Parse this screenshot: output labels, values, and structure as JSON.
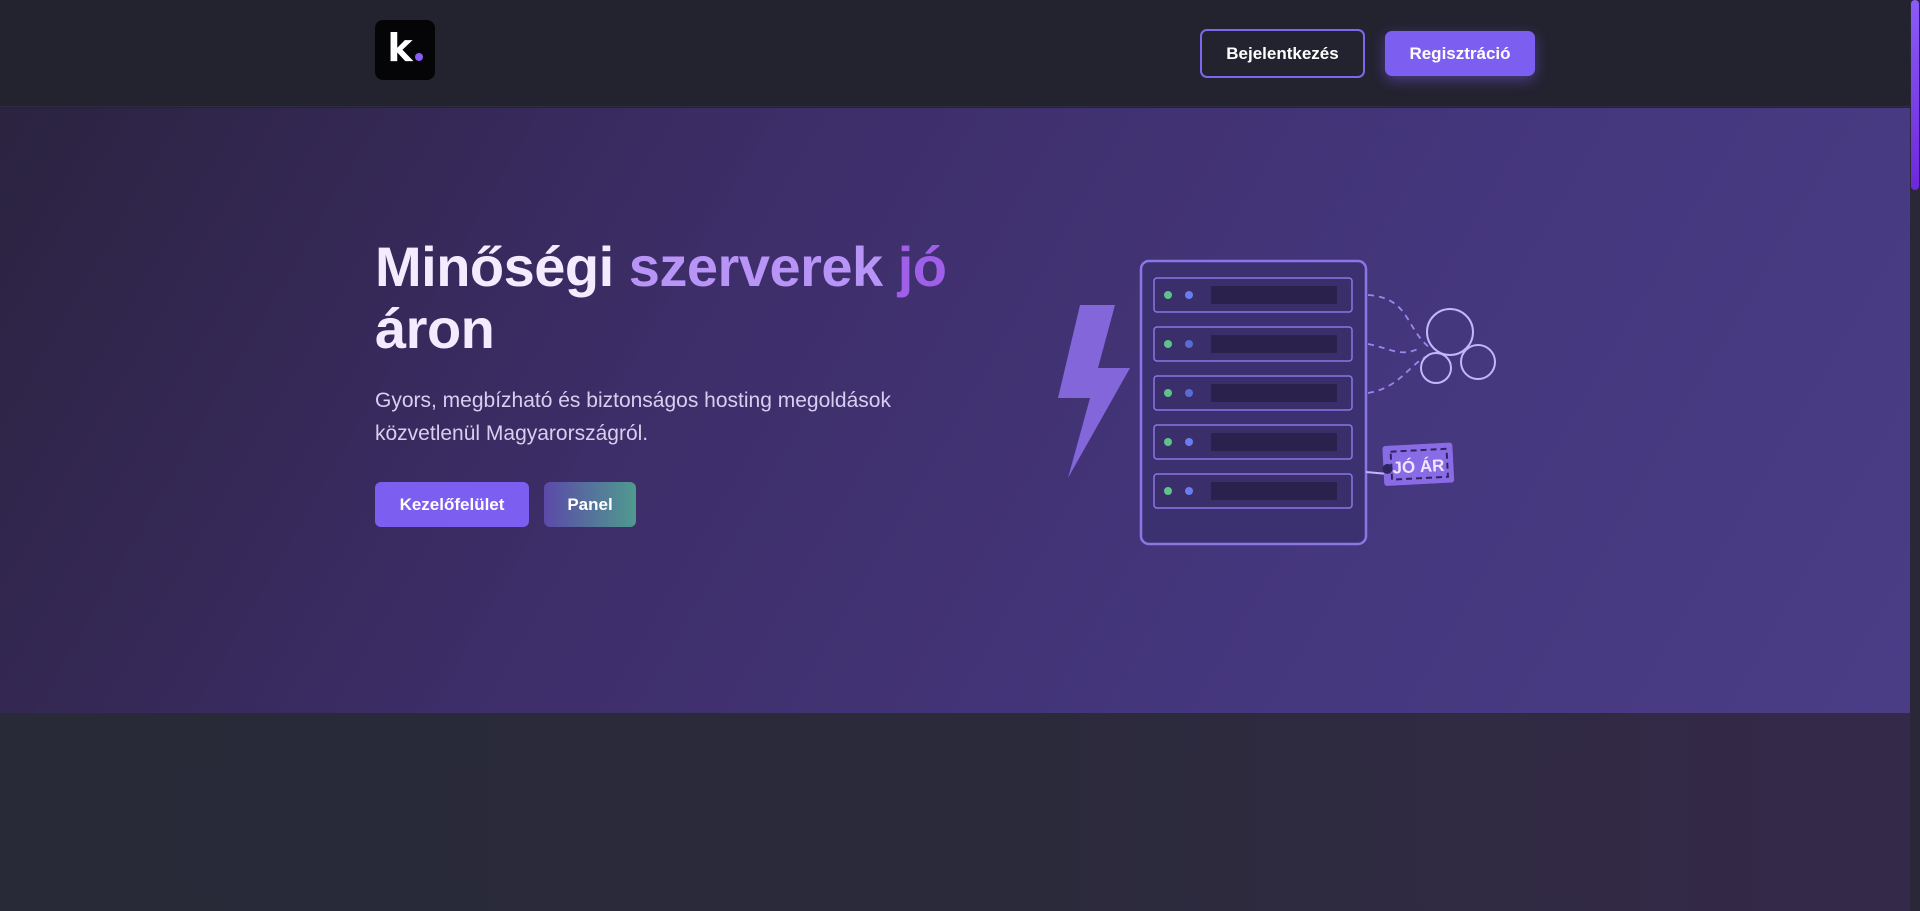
{
  "header": {
    "logo_letter": "k",
    "login_label": "Bejelentkezés",
    "register_label": "Regisztráció"
  },
  "hero": {
    "title_part1": "Minőségi ",
    "title_highlight1": "szerverek ",
    "title_highlight2": "jó",
    "title_part2": "áron",
    "subtitle": "Gyors, megbízható és biztonságos hosting megoldások közvetlenül Magyarországról.",
    "dashboard_label": "Kezelőfelület",
    "panel_label": "Panel",
    "price_tag": "JÓ ÁR"
  },
  "colors": {
    "accent": "#7c5ff0",
    "highlight_light": "#b794f6",
    "highlight_dark": "#9f5fe8",
    "background": "#23222f"
  },
  "icons": {
    "illustration": "server-rack-with-lightning-and-price-tag"
  }
}
